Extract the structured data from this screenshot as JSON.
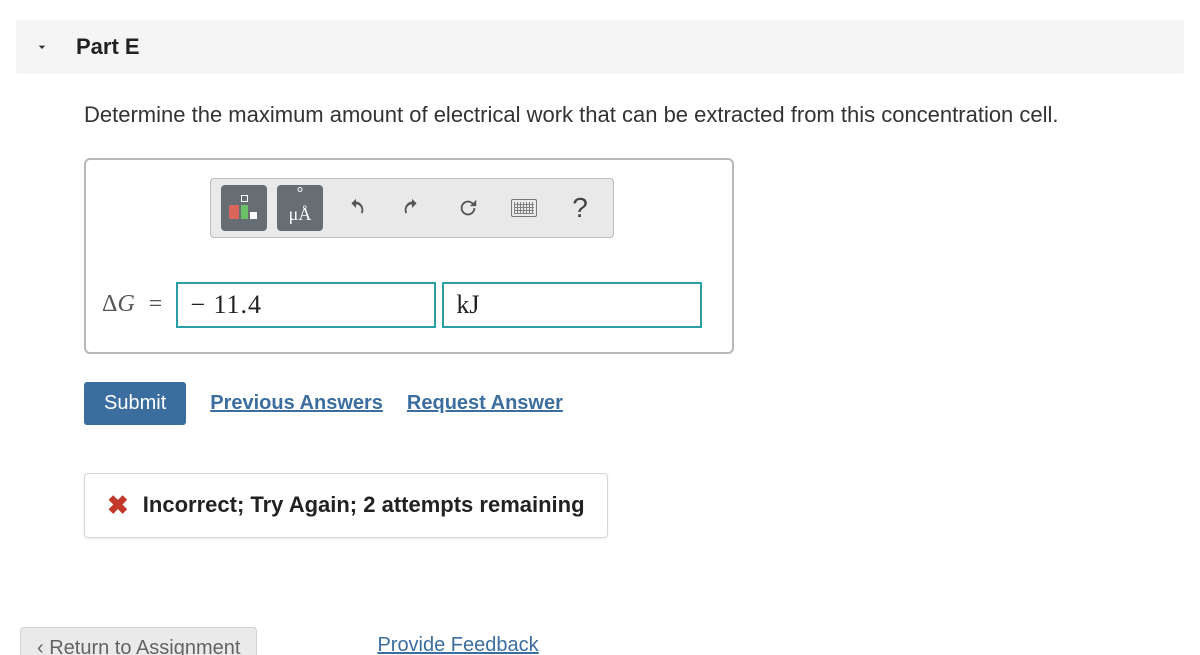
{
  "part": {
    "label": "Part E"
  },
  "prompt": "Determine the maximum amount of electrical work that can be extracted from this concentration cell.",
  "toolbar": {
    "special_chars": "μÅ",
    "help": "?"
  },
  "answer": {
    "var_delta": "Δ",
    "var_g": "G",
    "equals": "=",
    "value": "− 11.4",
    "unit": "kJ"
  },
  "actions": {
    "submit": "Submit",
    "previous": "Previous Answers",
    "request": "Request Answer"
  },
  "feedback": {
    "text": "Incorrect; Try Again; 2 attempts remaining"
  },
  "footer": {
    "return": "Return to Assignment",
    "provide": "Provide Feedback"
  }
}
